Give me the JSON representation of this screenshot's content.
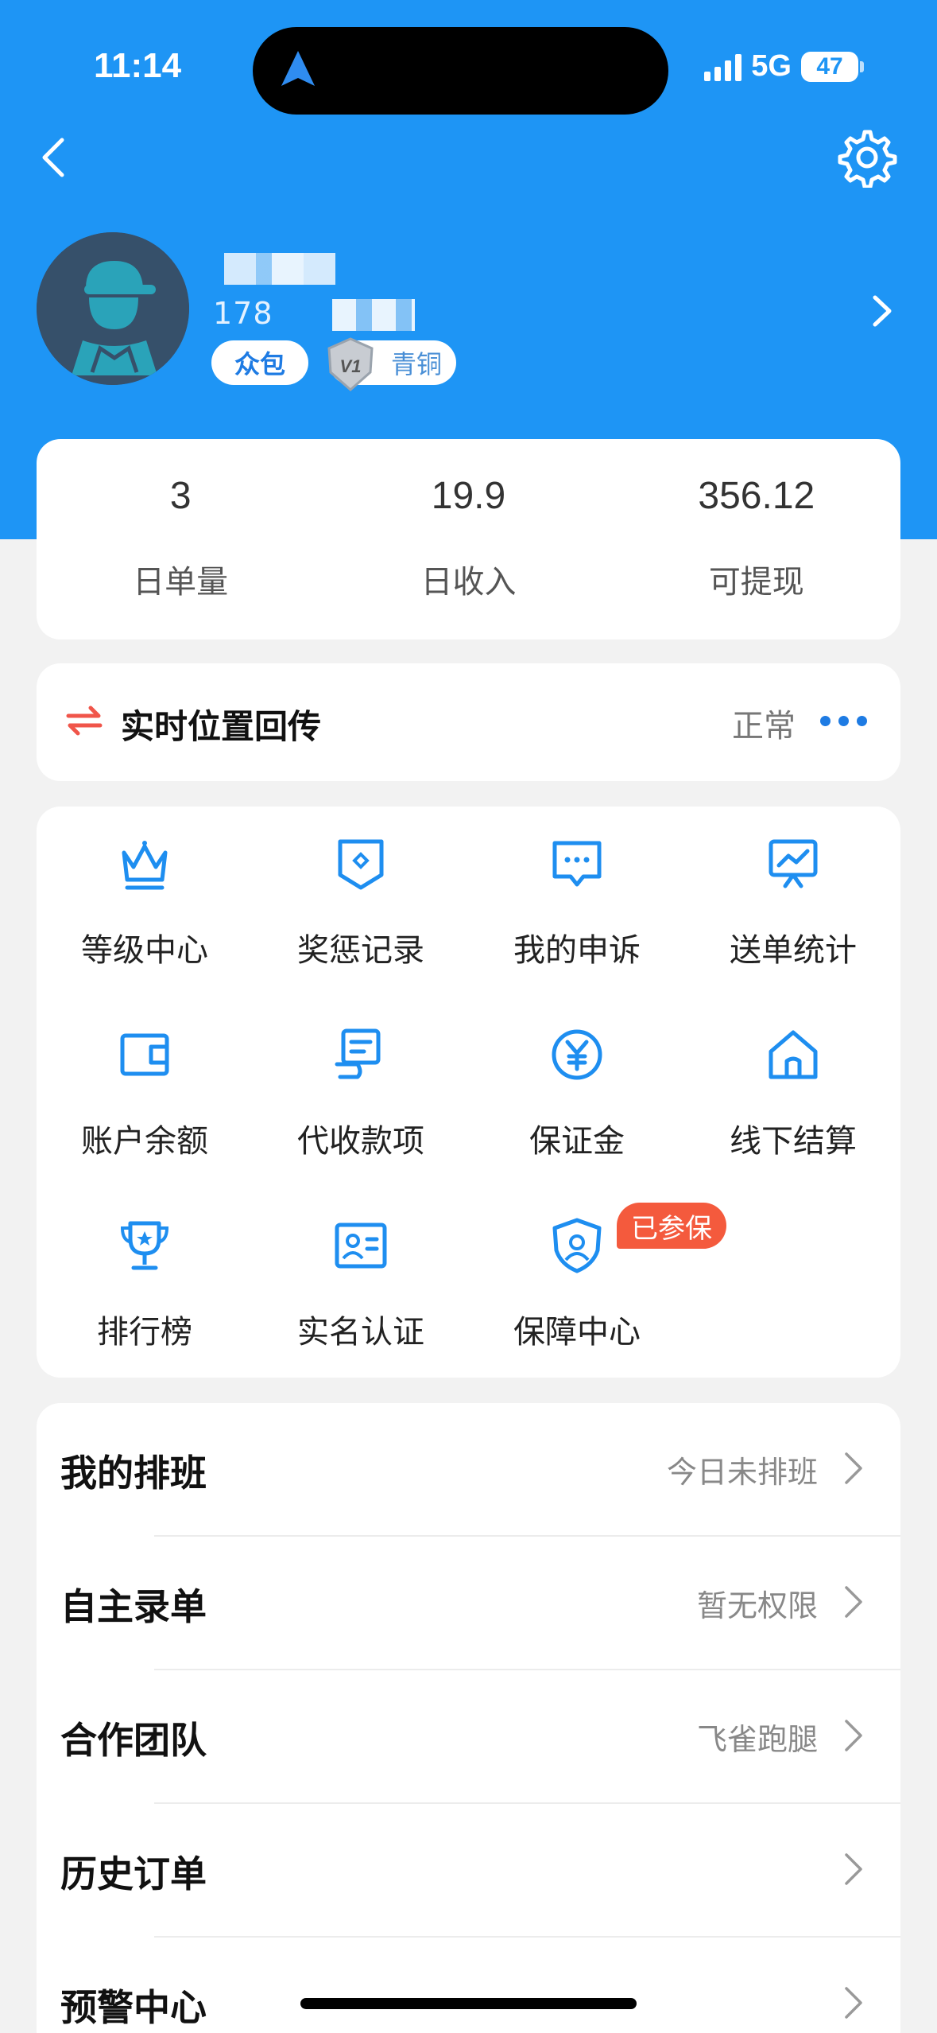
{
  "status_bar": {
    "time": "11:14",
    "network": "5G",
    "battery": "47"
  },
  "colors": {
    "brand": "#1e95f5",
    "accent": "#1e7be3",
    "badge_red": "#f45a3d"
  },
  "profile": {
    "phone_prefix": "178",
    "tag_crowd": "众包",
    "level_code": "V1",
    "level_name": "青铜"
  },
  "stats": [
    {
      "value": "3",
      "label": "日单量"
    },
    {
      "value": "19.9",
      "label": "日收入"
    },
    {
      "value": "356.12",
      "label": "可提现"
    }
  ],
  "realtime": {
    "title": "实时位置回传",
    "status": "正常"
  },
  "grid": [
    {
      "label": "等级中心",
      "icon": "crown-icon"
    },
    {
      "label": "奖惩记录",
      "icon": "shield-badge-icon"
    },
    {
      "label": "我的申诉",
      "icon": "chat-bubble-icon"
    },
    {
      "label": "送单统计",
      "icon": "chart-board-icon"
    },
    {
      "label": "账户余额",
      "icon": "wallet-icon"
    },
    {
      "label": "代收款项",
      "icon": "receipt-icon"
    },
    {
      "label": "保证金",
      "icon": "yuan-coin-icon"
    },
    {
      "label": "线下结算",
      "icon": "house-icon"
    },
    {
      "label": "排行榜",
      "icon": "trophy-icon"
    },
    {
      "label": "实名认证",
      "icon": "id-card-icon"
    },
    {
      "label": "保障中心",
      "icon": "shield-person-icon",
      "badge": "已参保"
    }
  ],
  "list": [
    {
      "title": "我的排班",
      "value": "今日未排班"
    },
    {
      "title": "自主录单",
      "value": "暂无权限"
    },
    {
      "title": "合作团队",
      "value": "飞雀跑腿"
    },
    {
      "title": "历史订单",
      "value": ""
    },
    {
      "title": "预警中心",
      "value": ""
    }
  ]
}
